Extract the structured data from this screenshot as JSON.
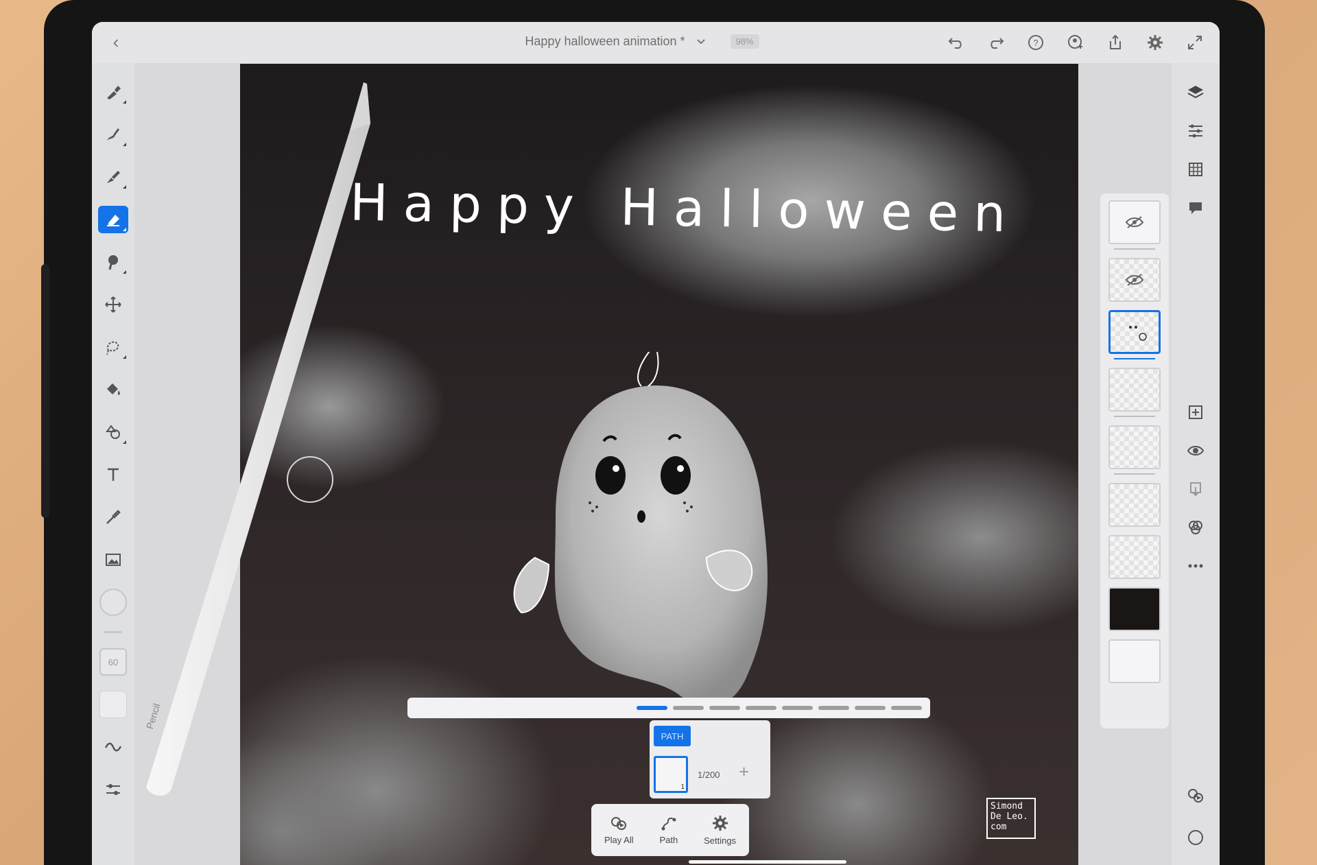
{
  "app": {
    "document_title": "Happy halloween animation *",
    "zoom": "98%"
  },
  "toolbar_left": {
    "brush_size": "60"
  },
  "canvas": {
    "text": "Happy Halloween",
    "signature": [
      "Simond",
      "De Leo.",
      "com"
    ]
  },
  "path_panel": {
    "tag": "PATH",
    "frame_count": "1/200",
    "frame_number": "1"
  },
  "bottom_bar": {
    "play_all": "Play All",
    "path": "Path",
    "settings": "Settings"
  },
  "pencil": {
    "brand": "Pencil"
  },
  "colors": {
    "accent": "#1473e6",
    "ui_bg": "#e5e5e7"
  }
}
